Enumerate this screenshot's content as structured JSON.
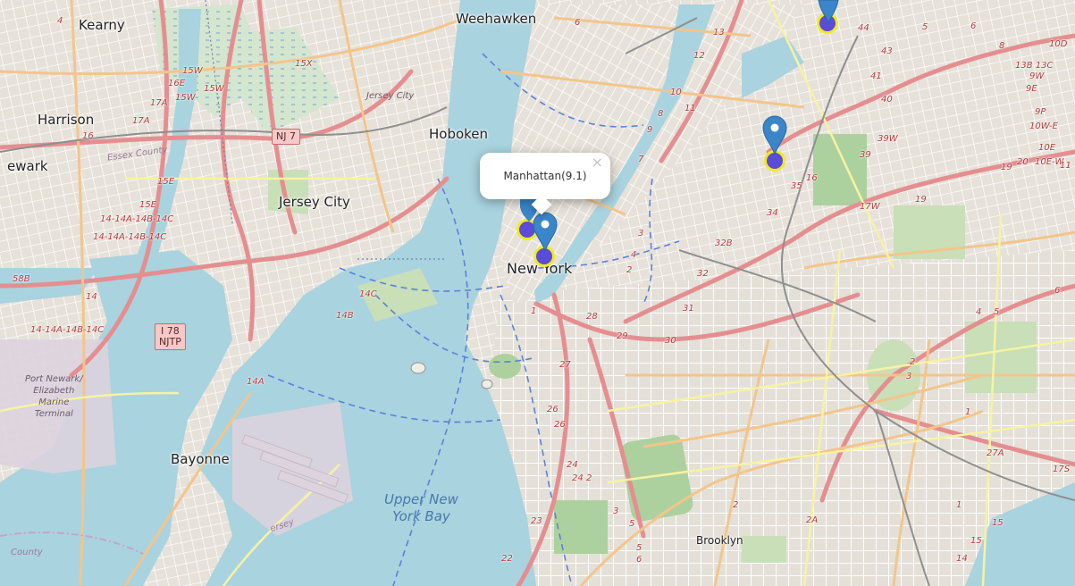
{
  "map": {
    "places": {
      "kearny": "Kearny",
      "weehawken": "Weehawken",
      "harrison": "Harrison",
      "hoboken": "Hoboken",
      "newark": "ewark",
      "jersey_city": "Jersey City",
      "jersey_city_small": "Jersey City",
      "new_york": "New York",
      "bayonne": "Bayonne",
      "brooklyn": "Brooklyn",
      "essex_county": "Essex County",
      "jersey_fragment": "ersey",
      "county_fragment": "County",
      "port_newark": "Port Newark/\nElizabeth\nMarine\nTerminal"
    },
    "water": {
      "upper_bay": "Upper New\nYork Bay"
    },
    "shields": {
      "nj7": "NJ 7",
      "i78": "I 78\nNJTP"
    },
    "exits": [
      {
        "id": "e4a",
        "text": "4"
      },
      {
        "id": "e15w",
        "text": "15W"
      },
      {
        "id": "e16e",
        "text": "16E"
      },
      {
        "id": "e15w2",
        "text": "15W"
      },
      {
        "id": "e17a",
        "text": "17A"
      },
      {
        "id": "e15x",
        "text": "15X"
      },
      {
        "id": "e15w3",
        "text": "15W"
      },
      {
        "id": "e17a2",
        "text": "17A"
      },
      {
        "id": "e16",
        "text": "16"
      },
      {
        "id": "e15e",
        "text": "15E"
      },
      {
        "id": "e15e2",
        "text": "15E"
      },
      {
        "id": "e14a",
        "text": "14-14A-14B-14C"
      },
      {
        "id": "e14b",
        "text": "14-14A-14B-14C"
      },
      {
        "id": "e58b",
        "text": "58B"
      },
      {
        "id": "e14",
        "text": "14"
      },
      {
        "id": "e14c",
        "text": "14-14A-14B-14C"
      },
      {
        "id": "e14a2",
        "text": "14A"
      },
      {
        "id": "e14c2",
        "text": "14C"
      },
      {
        "id": "e14b2",
        "text": "14B"
      },
      {
        "id": "e12",
        "text": "12"
      },
      {
        "id": "e13",
        "text": "13"
      },
      {
        "id": "e10",
        "text": "10"
      },
      {
        "id": "e11",
        "text": "11"
      },
      {
        "id": "e9",
        "text": "9"
      },
      {
        "id": "e8",
        "text": "8"
      },
      {
        "id": "e7",
        "text": "7"
      },
      {
        "id": "e6",
        "text": "6"
      },
      {
        "id": "e3",
        "text": "3"
      },
      {
        "id": "e2",
        "text": "2"
      },
      {
        "id": "e4b",
        "text": "4"
      },
      {
        "id": "e1",
        "text": "1"
      },
      {
        "id": "e28",
        "text": "28"
      },
      {
        "id": "e29",
        "text": "29"
      },
      {
        "id": "e30",
        "text": "30"
      },
      {
        "id": "e31",
        "text": "31"
      },
      {
        "id": "e32",
        "text": "32"
      },
      {
        "id": "e32b",
        "text": "32B"
      },
      {
        "id": "e34",
        "text": "34"
      },
      {
        "id": "e35",
        "text": "35"
      },
      {
        "id": "e16b",
        "text": "16"
      },
      {
        "id": "e39",
        "text": "39"
      },
      {
        "id": "e39w",
        "text": "39W"
      },
      {
        "id": "e40",
        "text": "40"
      },
      {
        "id": "e41",
        "text": "41"
      },
      {
        "id": "e43",
        "text": "43"
      },
      {
        "id": "e44",
        "text": "44"
      },
      {
        "id": "e5",
        "text": "5"
      },
      {
        "id": "e6b",
        "text": "6"
      },
      {
        "id": "e8b",
        "text": "8"
      },
      {
        "id": "e10d",
        "text": "10D"
      },
      {
        "id": "e13b",
        "text": "13B 13C"
      },
      {
        "id": "e9w",
        "text": "9W"
      },
      {
        "id": "e9e",
        "text": "9E"
      },
      {
        "id": "e9p",
        "text": "9P"
      },
      {
        "id": "e10we",
        "text": "10W-E"
      },
      {
        "id": "e10e",
        "text": "10E"
      },
      {
        "id": "e10ew",
        "text": "10E-W"
      },
      {
        "id": "e19",
        "text": "19"
      },
      {
        "id": "e20",
        "text": "20"
      },
      {
        "id": "e11b",
        "text": "11"
      },
      {
        "id": "e17w",
        "text": "17W"
      },
      {
        "id": "e19b",
        "text": "19"
      },
      {
        "id": "e27",
        "text": "27"
      },
      {
        "id": "e26",
        "text": "26"
      },
      {
        "id": "e26b",
        "text": "26"
      },
      {
        "id": "e24",
        "text": "24"
      },
      {
        "id": "e24b",
        "text": "24"
      },
      {
        "id": "e2b",
        "text": "2"
      },
      {
        "id": "e3b",
        "text": "3"
      },
      {
        "id": "e5b",
        "text": "5"
      },
      {
        "id": "e5c",
        "text": "5"
      },
      {
        "id": "e6c",
        "text": "6"
      },
      {
        "id": "e23",
        "text": "23"
      },
      {
        "id": "e22",
        "text": "22"
      },
      {
        "id": "e2a",
        "text": "2A"
      },
      {
        "id": "e1b",
        "text": "1"
      },
      {
        "id": "e27a",
        "text": "27A"
      },
      {
        "id": "e17s",
        "text": "17S"
      },
      {
        "id": "e15",
        "text": "15"
      },
      {
        "id": "e15b",
        "text": "15"
      },
      {
        "id": "e14d",
        "text": "14"
      },
      {
        "id": "e4c",
        "text": "4"
      },
      {
        "id": "e5d",
        "text": "5"
      },
      {
        "id": "e2c",
        "text": "2"
      },
      {
        "id": "e3c",
        "text": "3"
      },
      {
        "id": "e6d",
        "text": "6"
      },
      {
        "id": "e1c",
        "text": "1"
      },
      {
        "id": "e2d",
        "text": "2"
      }
    ],
    "marker_color": "#3a86c8",
    "circle_fill": "#5a4bd8",
    "circle_stroke": "#f2ea1e"
  },
  "popup": {
    "text": "Manhattan(9.1)",
    "close": "×"
  }
}
